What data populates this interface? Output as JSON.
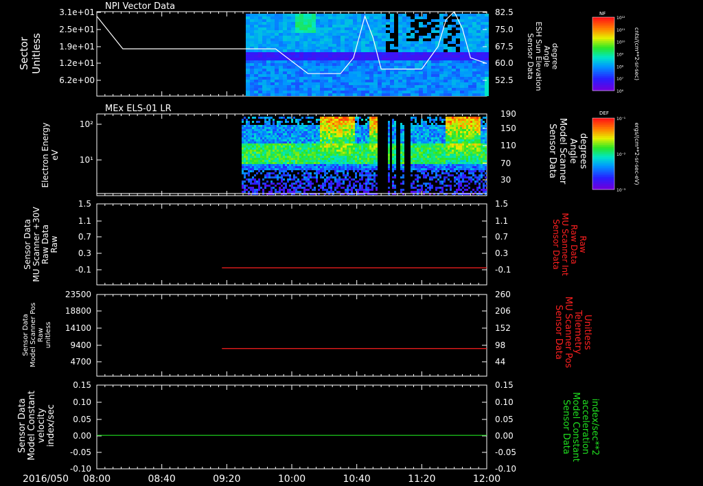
{
  "chart_data": [
    {
      "type": "heatmap",
      "title": "NPI Vector Data",
      "ylabel_left": [
        "Sector",
        "Unitless"
      ],
      "ylabel_right": [
        "Sensor Data",
        "ESH Sun Elevation",
        "Angle",
        "degree"
      ],
      "yticks_left": [
        "3.1e+01",
        "2.5e+01",
        "1.9e+01",
        "1.2e+01",
        "6.2e+00"
      ],
      "yticks_right": [
        "82.5",
        "75.0",
        "67.5",
        "60.0",
        "52.5"
      ],
      "ylim_right": [
        45,
        82.5
      ],
      "colorbar": {
        "label": "NF",
        "unit": "cnts/(cm**2-sr-sec)",
        "ticks": [
          "10¹²",
          "10¹¹",
          "10¹⁰",
          "10⁹",
          "10⁸",
          "10⁷",
          "10⁶"
        ]
      },
      "series": [
        {
          "name": "ESH Sun Elevation Angle",
          "x": [
            "08:00",
            "08:16",
            "08:40",
            "09:20",
            "09:50",
            "10:10",
            "10:30",
            "10:38",
            "10:45",
            "10:50",
            "10:55",
            "11:10",
            "11:20",
            "11:30",
            "11:35",
            "11:40",
            "11:45",
            "11:50",
            "12:00"
          ],
          "values": [
            80.5,
            66,
            66,
            66,
            66,
            55,
            55,
            62,
            80.5,
            71,
            57,
            57,
            57,
            67,
            79,
            82.5,
            75,
            62,
            59.5
          ]
        }
      ]
    },
    {
      "type": "heatmap",
      "title": "MEx ELS-01 LR",
      "ylabel_left": [
        "Electron Energy",
        "eV"
      ],
      "ylabel_right": [
        "Sensor Data",
        "Model Scanner",
        "Angle",
        "degrees"
      ],
      "yticks_left": [
        "10²",
        "10¹"
      ],
      "yticks_right": [
        "190",
        "150",
        "110",
        "70",
        "30"
      ],
      "ylim_right": [
        0,
        190
      ],
      "colorbar": {
        "label": "DEF",
        "unit": "ergs/(cm**2-sr-sec-eV)",
        "ticks": [
          "10⁻¹",
          "10⁻²",
          "10⁻³"
        ]
      },
      "series": [
        {
          "name": "Model Scanner Angle",
          "x": [
            "08:00",
            "12:00"
          ],
          "values": [
            5,
            5
          ]
        }
      ]
    },
    {
      "type": "line",
      "ylabel_left": [
        "Sensor Data",
        "MU Scanner +30V",
        "Raw Data",
        "Raw"
      ],
      "ylabel_right": [
        "Sensor Data",
        "MU Scanner Int",
        "Raw Data",
        "Raw"
      ],
      "yticks": [
        "1.5",
        "1.1",
        "0.7",
        "0.3",
        "-0.1"
      ],
      "ylim": [
        -0.4,
        1.5
      ],
      "color": "#ff2020",
      "series": [
        {
          "name": "MU Scanner Int Raw Data",
          "x": [
            "09:17",
            "12:00"
          ],
          "values": [
            0.0,
            0.0
          ]
        }
      ]
    },
    {
      "type": "line",
      "ylabel_left": [
        "Sensor Data",
        "Model Scanner Pos",
        "Raw",
        "unitless"
      ],
      "ylabel_right": [
        "Sensor Data",
        "MU Scanner Pos",
        "Telemetry",
        "Unitless"
      ],
      "yticks_left": [
        "23500",
        "18800",
        "14100",
        "9400",
        "4700"
      ],
      "yticks_right": [
        "260",
        "206",
        "152",
        "98",
        "44"
      ],
      "ylim_right": [
        0,
        260
      ],
      "color": "#ff2020",
      "series": [
        {
          "name": "MU Scanner Pos Telemetry",
          "x": [
            "09:17",
            "12:00"
          ],
          "values": [
            88,
            88
          ]
        }
      ]
    },
    {
      "type": "line",
      "ylabel_left": [
        "Sensor Data",
        "Model Constant",
        "velocity",
        "index/sec"
      ],
      "ylabel_right": [
        "Sensor Data",
        "Model Constant",
        "acceleration",
        "index/sec**2"
      ],
      "yticks": [
        "0.15",
        "0.10",
        "0.05",
        "0.00",
        "-0.05",
        "-0.10"
      ],
      "ylim": [
        -0.1,
        0.15
      ],
      "color": "#20e020",
      "series": [
        {
          "name": "Model Constant",
          "x": [
            "08:00",
            "12:00"
          ],
          "values": [
            0.0,
            0.0
          ]
        }
      ]
    }
  ],
  "xaxis": {
    "date_label": "2016/050",
    "ticks": [
      "08:00",
      "08:40",
      "09:20",
      "10:00",
      "10:40",
      "11:20",
      "12:00"
    ],
    "range": [
      "08:00",
      "12:00"
    ]
  }
}
